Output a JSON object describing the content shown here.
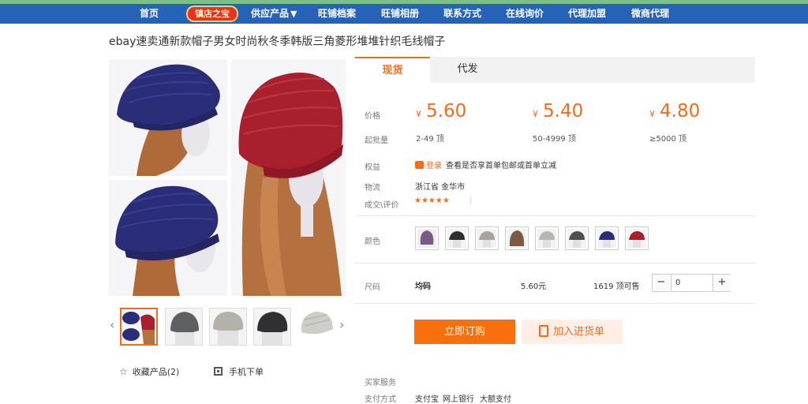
{
  "nav": {
    "items": [
      "首页",
      "供应产品",
      "旺铺档案",
      "旺铺相册",
      "联系方式",
      "在线询价",
      "代理加盟",
      "微商代理"
    ],
    "badge": "镇店之宝",
    "dropdown_arrow": "▼"
  },
  "product": {
    "title": "ebay速卖通新款帽子男女时尚秋冬季韩版三角菱形堆堆针织毛线帽子"
  },
  "gallery": {
    "prev_arrow": "‹",
    "next_arrow": "›",
    "favorite_label": "收藏产品(2)",
    "mobile_order_label": "手机下单"
  },
  "tabs": [
    "现货",
    "代发"
  ],
  "pricing": {
    "price_label": "价格",
    "qty_label": "起批量",
    "currency": "¥",
    "tiers": [
      {
        "price": "5.60",
        "range": "2-49 顶"
      },
      {
        "price": "5.40",
        "range": "50-4999 顶"
      },
      {
        "price": "4.80",
        "range": "≥5000 顶"
      }
    ]
  },
  "benefits": {
    "label": "权益",
    "login_link": "登录",
    "text": "查看是否享首单包邮或首单立减"
  },
  "logistics": {
    "label": "物流",
    "value": "浙江省 金华市"
  },
  "reviews": {
    "label": "成交\\评价",
    "rating": 4.5,
    "stars": "★★★★★",
    "divider": "|"
  },
  "color": {
    "label": "颜色",
    "swatches": [
      "purple",
      "black",
      "grey",
      "brown",
      "light-grey",
      "dark-grey",
      "navy",
      "red"
    ]
  },
  "size": {
    "label": "尺码",
    "value": "均码",
    "unit_price": "5.60元",
    "stock": "1619 顶可售",
    "quantity": "0",
    "minus": "−",
    "plus": "+"
  },
  "buttons": {
    "buy_now": "立即订购",
    "add_to_list": "加入进货单"
  },
  "services": {
    "buyer_label": "买家服务",
    "payment_label": "支付方式",
    "payment_methods": [
      "支付宝",
      "网上银行",
      "大额支付"
    ]
  },
  "colors": {
    "nav_bg": "#2563b8",
    "accent": "#f06d1e",
    "buy_button": "#f8700e"
  }
}
